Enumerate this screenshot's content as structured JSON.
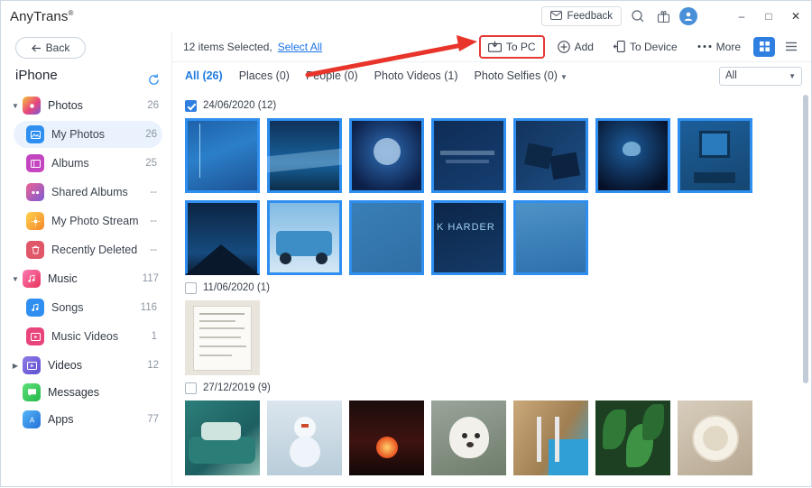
{
  "titlebar": {
    "brand": "AnyTrans",
    "brand_sup": "®",
    "feedback_label": "Feedback",
    "icons": [
      "mail-icon",
      "search-icon",
      "gift-icon",
      "avatar-icon",
      "chevron-down-icon"
    ],
    "minimize": "–",
    "maximize": "□",
    "close": "✕"
  },
  "sidebar": {
    "back_label": "Back",
    "device_label": "iPhone",
    "refresh_icon": "refresh-icon",
    "groups": [
      {
        "label": "Photos",
        "count": "26",
        "icon": "photos-icon",
        "color": "#e8457c",
        "expanded": true,
        "items": [
          {
            "label": "My Photos",
            "count": "26",
            "icon": "my-photos-icon",
            "color": "#2f8ff0",
            "active": true
          },
          {
            "label": "Albums",
            "count": "25",
            "icon": "albums-icon",
            "color": "#c345c0",
            "active": false
          },
          {
            "label": "Shared Albums",
            "count": "--",
            "icon": "shared-albums-icon",
            "color": "#e8457c",
            "active": false
          },
          {
            "label": "My Photo Stream",
            "count": "--",
            "icon": "photo-stream-icon",
            "color": "#f4a62a",
            "active": false
          },
          {
            "label": "Recently Deleted",
            "count": "--",
            "icon": "trash-icon",
            "color": "#e0576a",
            "active": false
          }
        ]
      },
      {
        "label": "Music",
        "count": "117",
        "icon": "music-icon",
        "color": "#e8457c",
        "expanded": true,
        "items": [
          {
            "label": "Songs",
            "count": "116",
            "icon": "songs-icon",
            "color": "#2f8ff0",
            "active": false
          },
          {
            "label": "Music Videos",
            "count": "1",
            "icon": "music-videos-icon",
            "color": "#e8457c",
            "active": false
          }
        ]
      },
      {
        "label": "Videos",
        "count": "12",
        "icon": "videos-icon",
        "color": "#7b5cd6",
        "expanded": false,
        "items": []
      },
      {
        "label": "Messages",
        "count": "",
        "icon": "messages-icon",
        "color": "#3ec55f",
        "expanded": false,
        "items": []
      },
      {
        "label": "Apps",
        "count": "77",
        "icon": "apps-icon",
        "color": "#2f8ff0",
        "expanded": false,
        "items": []
      }
    ]
  },
  "toolbar": {
    "selected_text": "12 items Selected,",
    "select_all_label": "Select All",
    "to_pc_label": "To PC",
    "add_label": "Add",
    "to_device_label": "To Device",
    "more_label": "More",
    "grid_view_icon": "grid-view-icon",
    "list_view_icon": "list-view-icon"
  },
  "tabs": [
    {
      "label": "All (26)",
      "active": true,
      "dropdown": false
    },
    {
      "label": "Places (0)",
      "active": false,
      "dropdown": false
    },
    {
      "label": "People (0)",
      "active": false,
      "dropdown": false
    },
    {
      "label": "Photo Videos (1)",
      "active": false,
      "dropdown": false
    },
    {
      "label": "Photo Selfies (0)",
      "active": false,
      "dropdown": true
    }
  ],
  "filter": {
    "value": "All"
  },
  "gallery": {
    "sections": [
      {
        "date": "24/06/2020 (12)",
        "checked": true,
        "thumbs": [
          {
            "name": "photo-blue-gradient",
            "selected": true,
            "style": "g1"
          },
          {
            "name": "photo-ocean-wave",
            "selected": true,
            "style": "g2"
          },
          {
            "name": "photo-jellyfish-moon",
            "selected": true,
            "style": "g3"
          },
          {
            "name": "photo-dark-blue-text",
            "selected": true,
            "style": "g4"
          },
          {
            "name": "photo-rocks",
            "selected": true,
            "style": "g5"
          },
          {
            "name": "photo-jellyfish",
            "selected": true,
            "style": "g6"
          },
          {
            "name": "photo-wall-frame",
            "selected": true,
            "style": "g7"
          },
          {
            "name": "photo-mountain-night",
            "selected": true,
            "style": "g8"
          },
          {
            "name": "photo-blue-truck",
            "selected": true,
            "style": "g9"
          },
          {
            "name": "photo-blue-plain",
            "selected": true,
            "style": "g10"
          },
          {
            "name": "photo-work-harder",
            "selected": true,
            "style": "g11"
          },
          {
            "name": "photo-blue-soft",
            "selected": true,
            "style": "g12"
          }
        ]
      },
      {
        "date": "11/06/2020 (1)",
        "checked": false,
        "thumbs": [
          {
            "name": "photo-document-scan",
            "selected": false,
            "style": "d1"
          }
        ]
      },
      {
        "date": "27/12/2019 (9)",
        "checked": false,
        "thumbs": [
          {
            "name": "photo-green-car",
            "selected": false,
            "style": "s1"
          },
          {
            "name": "photo-snowman",
            "selected": false,
            "style": "s2"
          },
          {
            "name": "photo-sunset-red",
            "selected": false,
            "style": "s3"
          },
          {
            "name": "photo-white-dog",
            "selected": false,
            "style": "s4"
          },
          {
            "name": "photo-pool-ladder",
            "selected": false,
            "style": "s5"
          },
          {
            "name": "photo-green-leaves",
            "selected": false,
            "style": "s6"
          },
          {
            "name": "photo-plate-table",
            "selected": false,
            "style": "s7"
          }
        ]
      }
    ]
  },
  "annotation": {
    "arrow_color": "#e8342a",
    "highlight_color": "#e53935"
  }
}
